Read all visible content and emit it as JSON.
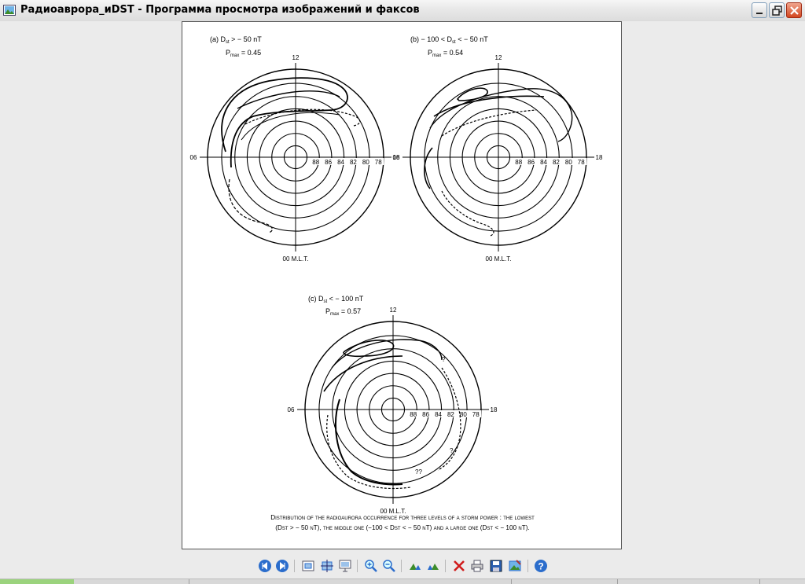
{
  "window": {
    "title": "Радиоаврора_иDST - Программа просмотра изображений и факсов",
    "icon": "image-viewer-icon"
  },
  "document": {
    "panel_a": {
      "title": "(a) D",
      "title_sub": "st",
      "title_rest": " > − 50 nT",
      "pmax_label": "P",
      "pmax_sub": "max",
      "pmax_value": " = 0.45"
    },
    "panel_b": {
      "title": "(b) − 100 < D",
      "title_sub": "st",
      "title_rest": " < − 50 nT",
      "pmax_label": "P",
      "pmax_sub": "max",
      "pmax_value": " = 0.54"
    },
    "panel_c": {
      "title": "(c) D",
      "title_sub": "st",
      "title_rest": " < − 100 nT",
      "pmax_label": "P",
      "pmax_sub": "max",
      "pmax_value": " = 0.57"
    },
    "dial": {
      "top": "12",
      "left": "06",
      "right": "18",
      "bottom": "00 M.L.T.",
      "latitudes": [
        "88",
        "86",
        "84",
        "82",
        "80",
        "78"
      ]
    },
    "caption_line1": "Distribution of the radioaurora occurrence for three levels of a storm power : the lowest",
    "caption_line2": "(Dst > − 50 nT), the middle one (−100 < Dst < − 50 nT) and a large one (Dst < − 100 nT).",
    "annotations": {
      "c_q1": "?",
      "c_q2": "?",
      "c_q3": "??"
    }
  },
  "toolbar": {
    "buttons": [
      "previous-image-icon",
      "next-image-icon",
      "best-fit-icon",
      "actual-size-icon",
      "slideshow-icon",
      "zoom-in-icon",
      "zoom-out-icon",
      "rotate-clockwise-icon",
      "rotate-counterclockwise-icon",
      "delete-icon",
      "print-icon",
      "save-icon",
      "open-in-editor-icon",
      "help-icon"
    ]
  },
  "colors": {
    "accent_blue": "#2b6dcc",
    "close_red": "#d2461f",
    "delete_red": "#d01a1a"
  }
}
